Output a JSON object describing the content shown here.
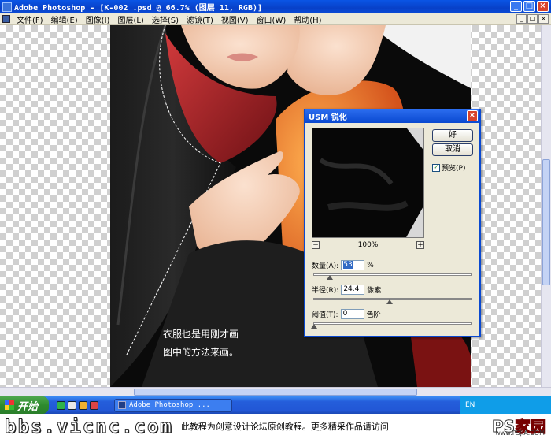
{
  "window": {
    "title": "Adobe Photoshop - [K-002 .psd @ 66.7% (图层 11, RGB)]",
    "minimize": "_",
    "maximize": "□",
    "close": "×"
  },
  "menu": {
    "items": [
      "文件(F)",
      "编辑(E)",
      "图像(I)",
      "图层(L)",
      "选择(S)",
      "滤镜(T)",
      "视图(V)",
      "窗口(W)",
      "帮助(H)"
    ]
  },
  "annotation": {
    "line1": "衣服也是用刚才画",
    "line2": "图中的方法来画。"
  },
  "dialog": {
    "title": "USM 锐化",
    "ok_label": "好",
    "cancel_label": "取消",
    "preview_label": "预览(P)",
    "preview_checked": true,
    "zoom": "100%",
    "zoom_out": "−",
    "zoom_in": "+",
    "amount": {
      "label": "数量(A):",
      "value": "53",
      "unit": "%",
      "level": 0.1
    },
    "radius": {
      "label": "半径(R):",
      "value": "24.4",
      "unit": "像素",
      "level": 0.48
    },
    "threshold": {
      "label": "阈值(T):",
      "value": "0",
      "unit": "色阶",
      "level": 0.0
    }
  },
  "taskbar": {
    "start_label": "开始",
    "task_label": "Adobe Photoshop ...",
    "tray_text": "EN"
  },
  "banner": {
    "site": "bbs.vicnc.com",
    "notice": "此教程为创意设计论坛原创教程。更多精采作品请访问",
    "logo_ps": "PS",
    "logo_accent": "家园",
    "logo_url": "www.PSJIA.COM"
  },
  "colors": {
    "titlebar": "#0a49d0",
    "dialog_bg": "#ece9d8",
    "scarf": "#b3262b",
    "orange": "#e8752a",
    "skin": "#f6cfb4"
  }
}
